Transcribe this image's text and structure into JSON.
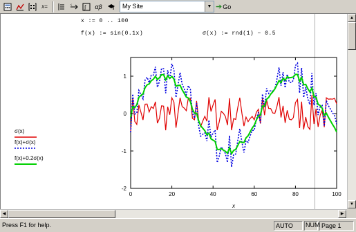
{
  "toolbar": {
    "site_combo_value": "My Site",
    "go_label": "Go",
    "icons": [
      "calculator-icon",
      "graph-icon",
      "matrix-icon",
      "evaluate-icon",
      "programming-icon",
      "symbolic-icon",
      "calculus-icon",
      "greek-icon",
      "resources-icon"
    ]
  },
  "worksheet": {
    "range_def": "x := 0 .. 100",
    "f_def": "f(x) := sin(0.1x)",
    "sigma_def": "σ(x) := rnd(1) − 0.5"
  },
  "legend": {
    "items": [
      {
        "label": "σ(x)",
        "color": "#e00000",
        "style": "solid"
      },
      {
        "label": "f(x)+σ(x)",
        "color": "#0000e0",
        "style": "dotted"
      },
      {
        "label": "f(x)+0.2σ(x)",
        "color": "#00d000",
        "style": "solid"
      }
    ]
  },
  "chart_data": {
    "type": "line",
    "xlabel": "x",
    "ylabel": "",
    "xlim": [
      0,
      100
    ],
    "ylim": [
      -2,
      1.5
    ],
    "x_ticks": [
      0,
      20,
      40,
      60,
      80,
      100
    ],
    "y_ticks": [
      1,
      0,
      -1,
      -2
    ],
    "grid": false,
    "series": [
      {
        "name": "σ(x)",
        "color": "#e00000",
        "style": "solid",
        "values": "random uniform in [-0.5, 0.5] over x = 0..100"
      },
      {
        "name": "f(x)+σ(x)",
        "color": "#0000e0",
        "style": "dotted",
        "values": "sin(0.1x) + σ(x) over x = 0..100"
      },
      {
        "name": "f(x)+0.2σ(x)",
        "color": "#00d000",
        "style": "solid",
        "values": "sin(0.1x) + 0.2σ(x) over x = 0..100"
      }
    ]
  },
  "statusbar": {
    "help_text": "Press F1 for help.",
    "mode": "AUTO",
    "num": "NUM",
    "page": "Page 1"
  }
}
